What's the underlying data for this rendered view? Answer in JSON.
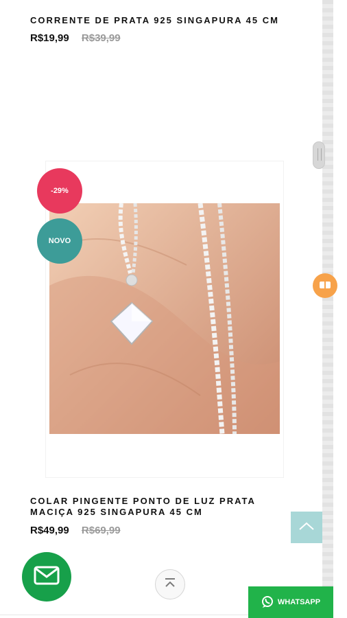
{
  "product1": {
    "title": "CORRENTE DE PRATA 925 SINGAPURA 45 CM",
    "price": "R$19,99",
    "old_price": "R$39,99"
  },
  "product2": {
    "discount_badge": "-29%",
    "new_badge": "NOVO",
    "title_line1": "COLAR PINGENTE PONTO DE LUZ PRATA",
    "title_line2": "MACIÇA 925 SINGAPURA 45 CM",
    "price": "R$49,99",
    "old_price": "R$69,99"
  },
  "icons": {
    "email": "mail-icon",
    "whatsapp": "whatsapp-icon",
    "back_to_top": "chevron-up-icon",
    "floating": "gift-icon"
  },
  "whatsapp": {
    "label": "WHATSAPP"
  },
  "colors": {
    "sale_badge": "#e8395d",
    "new_badge": "#3d9c98",
    "email_fab": "#17a04a",
    "whatsapp_btn": "#21b34a",
    "to_top_square": "#a8d7d7",
    "floating_pill": "#f7a24a"
  }
}
